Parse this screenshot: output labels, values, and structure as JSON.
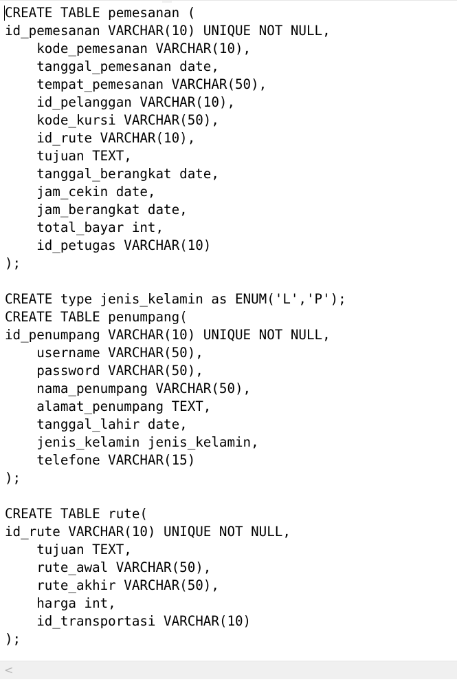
{
  "editor": {
    "lines": [
      "CREATE TABLE pemesanan (",
      "id_pemesanan VARCHAR(10) UNIQUE NOT NULL,",
      "    kode_pemesanan VARCHAR(10),",
      "    tanggal_pemesanan date,",
      "    tempat_pemesanan VARCHAR(50),",
      "    id_pelanggan VARCHAR(10),",
      "    kode_kursi VARCHAR(50),",
      "    id_rute VARCHAR(10),",
      "    tujuan TEXT,",
      "    tanggal_berangkat date,",
      "    jam_cekin date,",
      "    jam_berangkat date,",
      "    total_bayar int,",
      "    id_petugas VARCHAR(10)",
      ");",
      "",
      "CREATE type jenis_kelamin as ENUM('L','P');",
      "CREATE TABLE penumpang(",
      "id_penumpang VARCHAR(10) UNIQUE NOT NULL,",
      "    username VARCHAR(50),",
      "    password VARCHAR(50),",
      "    nama_penumpang VARCHAR(50),",
      "    alamat_penumpang TEXT,",
      "    tanggal_lahir date,",
      "    jenis_kelamin jenis_kelamin,",
      "    telefone VARCHAR(15)",
      ");",
      "",
      "CREATE TABLE rute(",
      "id_rute VARCHAR(10) UNIQUE NOT NULL,",
      "    tujuan TEXT,",
      "    rute_awal VARCHAR(50),",
      "    rute_akhir VARCHAR(50),",
      "    harga int,",
      "    id_transportasi VARCHAR(10)",
      ");"
    ]
  },
  "scrollbar": {
    "left_arrow_glyph": "<",
    "left_arrow_icon": "chevron-left-icon"
  },
  "colors": {
    "text": "#000000",
    "background": "#ffffff",
    "scrollbar_track": "#f0f0f0",
    "scrollbar_arrow": "#b5b5b5"
  }
}
